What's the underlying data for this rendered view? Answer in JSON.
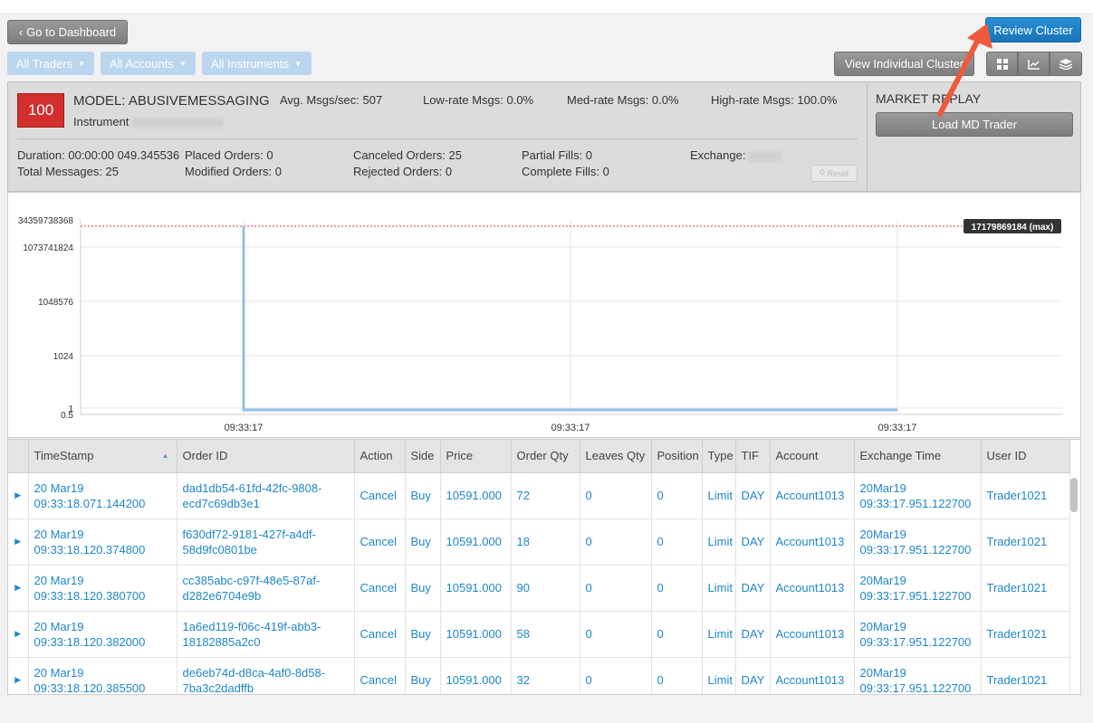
{
  "nav": {
    "dashboard_label": "Go to Dashboard",
    "review_label": "Review Cluster"
  },
  "filters": {
    "traders": "All Traders",
    "accounts": "All Accounts",
    "instruments": "All Instruments"
  },
  "toolbar": {
    "view_individual_label": "View Individual Cluster"
  },
  "summary": {
    "score": "100",
    "model": "MODEL: ABUSIVEMESSAGING",
    "instrument_label": "Instrument",
    "avg_msgs": "Avg. Msgs/sec: 507",
    "low_rate": "Low-rate Msgs: 0.0%",
    "med_rate": "Med-rate Msgs: 0.0%",
    "high_rate": "High-rate Msgs: 100.0%",
    "duration": "Duration: 00:00:00 049.345536",
    "total_messages": "Total Messages: 25",
    "placed": "Placed Orders: 0",
    "modified": "Modified Orders: 0",
    "canceled": "Canceled Orders: 25",
    "rejected": "Rejected Orders: 0",
    "partial": "Partial Fills: 0",
    "complete": "Complete Fills: 0",
    "exchange_label": "Exchange:",
    "reset_label": "Reset"
  },
  "market_replay": {
    "title": "MARKET REPLAY",
    "load_label": "Load MD Trader"
  },
  "chart_data": {
    "type": "line",
    "y_scale": "log",
    "y_ticks": [
      "34359738368",
      "1073741824",
      "1048576",
      "1024",
      "1",
      "0.5"
    ],
    "x_ticks": [
      "09:33:17",
      "09:33:17",
      "09:33:17"
    ],
    "max_label": "17179869184 (max)",
    "max_value": 17179869184,
    "series_color": "#90c0ec",
    "threshold_color": "#e03a3a",
    "grid": true
  },
  "table": {
    "columns": [
      "TimeStamp",
      "Order ID",
      "Action",
      "Side",
      "Price",
      "Order Qty",
      "Leaves Qty",
      "Position",
      "Type",
      "TIF",
      "Account",
      "Exchange Time",
      "User ID"
    ],
    "rows": [
      {
        "ts1": "20 Mar19",
        "ts2": "09:33:18.071.144200",
        "id1": "dad1db54-61fd-42fc-9808-",
        "id2": "ecd7c69db3e1",
        "action": "Cancel",
        "side": "Buy",
        "price": "10591.000",
        "qty": "72",
        "leaves": "0",
        "position": "0",
        "type": "Limit",
        "tif": "DAY",
        "account": "Account1013",
        "ex1": "20Mar19",
        "ex2": "09:33:17.951.122700",
        "user": "Trader1021"
      },
      {
        "ts1": "20 Mar19",
        "ts2": "09:33:18.120.374800",
        "id1": "f630df72-9181-427f-a4df-",
        "id2": "58d9fc0801be",
        "action": "Cancel",
        "side": "Buy",
        "price": "10591.000",
        "qty": "18",
        "leaves": "0",
        "position": "0",
        "type": "Limit",
        "tif": "DAY",
        "account": "Account1013",
        "ex1": "20Mar19",
        "ex2": "09:33:17.951.122700",
        "user": "Trader1021"
      },
      {
        "ts1": "20 Mar19",
        "ts2": "09:33:18.120.380700",
        "id1": "cc385abc-c97f-48e5-87af-",
        "id2": "d282e6704e9b",
        "action": "Cancel",
        "side": "Buy",
        "price": "10591.000",
        "qty": "90",
        "leaves": "0",
        "position": "0",
        "type": "Limit",
        "tif": "DAY",
        "account": "Account1013",
        "ex1": "20Mar19",
        "ex2": "09:33:17.951.122700",
        "user": "Trader1021"
      },
      {
        "ts1": "20 Mar19",
        "ts2": "09:33:18.120.382000",
        "id1": "1a6ed119-f06c-419f-abb3-",
        "id2": "18182885a2c0",
        "action": "Cancel",
        "side": "Buy",
        "price": "10591.000",
        "qty": "58",
        "leaves": "0",
        "position": "0",
        "type": "Limit",
        "tif": "DAY",
        "account": "Account1013",
        "ex1": "20Mar19",
        "ex2": "09:33:17.951.122700",
        "user": "Trader1021"
      },
      {
        "ts1": "20 Mar19",
        "ts2": "09:33:18.120.385500",
        "id1": "de6eb74d-d8ca-4af0-8d58-",
        "id2": "7ba3c2dadffb",
        "action": "Cancel",
        "side": "Buy",
        "price": "10591.000",
        "qty": "32",
        "leaves": "0",
        "position": "0",
        "type": "Limit",
        "tif": "DAY",
        "account": "Account1013",
        "ex1": "20Mar19",
        "ex2": "09:33:17.951.122700",
        "user": "Trader1021"
      }
    ]
  }
}
